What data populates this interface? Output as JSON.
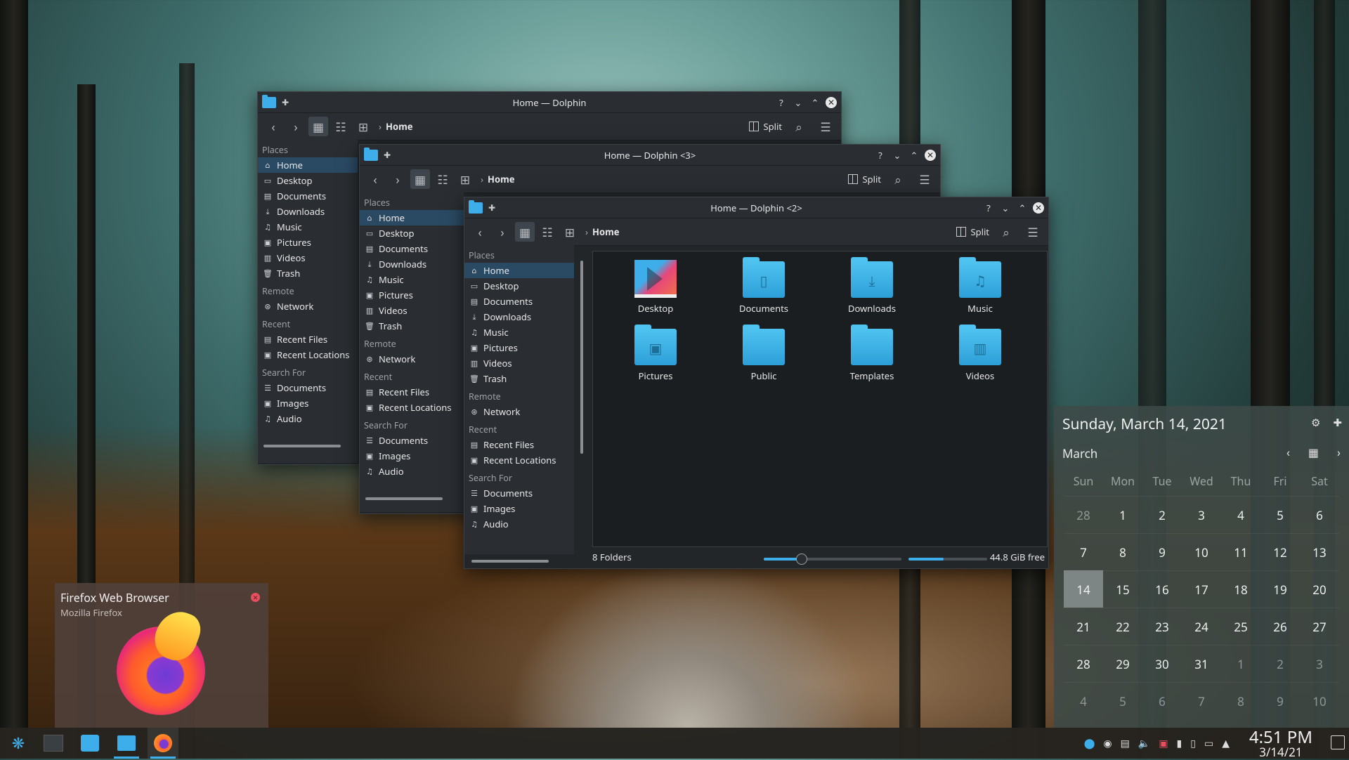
{
  "windows": [
    {
      "title": "Home — Dolphin"
    },
    {
      "title": "Home — Dolphin <3>"
    },
    {
      "title": "Home — Dolphin <2>"
    }
  ],
  "toolbar": {
    "split_label": "Split",
    "breadcrumb": "Home"
  },
  "places": {
    "sections": {
      "places": "Places",
      "remote": "Remote",
      "recent": "Recent",
      "search_for": "Search For"
    },
    "places_items": [
      "Home",
      "Desktop",
      "Documents",
      "Downloads",
      "Music",
      "Pictures",
      "Videos",
      "Trash"
    ],
    "remote_items": [
      "Network"
    ],
    "recent_items": [
      "Recent Files",
      "Recent Locations"
    ],
    "search_items": [
      "Documents",
      "Images",
      "Audio"
    ]
  },
  "files": [
    {
      "name": "Desktop",
      "icon": "desktop-folder-icon"
    },
    {
      "name": "Documents",
      "icon": "documents-folder-icon"
    },
    {
      "name": "Downloads",
      "icon": "downloads-folder-icon"
    },
    {
      "name": "Music",
      "icon": "music-folder-icon"
    },
    {
      "name": "Pictures",
      "icon": "pictures-folder-icon"
    },
    {
      "name": "Public",
      "icon": "folder-icon"
    },
    {
      "name": "Templates",
      "icon": "folder-icon"
    },
    {
      "name": "Videos",
      "icon": "videos-folder-icon"
    }
  ],
  "statusbar": {
    "folders": "8 Folders",
    "free": "44.8 GiB free",
    "zoom_fraction": 0.27,
    "disk_used_fraction": 0.45
  },
  "calendar": {
    "full_date": "Sunday, March 14, 2021",
    "month": "March",
    "weekdays": [
      "Sun",
      "Mon",
      "Tue",
      "Wed",
      "Thu",
      "Fri",
      "Sat"
    ],
    "days": [
      [
        "28",
        "1",
        "2",
        "3",
        "4",
        "5",
        "6"
      ],
      [
        "7",
        "8",
        "9",
        "10",
        "11",
        "12",
        "13"
      ],
      [
        "14",
        "15",
        "16",
        "17",
        "18",
        "19",
        "20"
      ],
      [
        "21",
        "22",
        "23",
        "24",
        "25",
        "26",
        "27"
      ],
      [
        "28",
        "29",
        "30",
        "31",
        "1",
        "2",
        "3"
      ],
      [
        "4",
        "5",
        "6",
        "7",
        "8",
        "9",
        "10"
      ]
    ],
    "today": "14"
  },
  "notification": {
    "title": "Firefox Web Browser",
    "subtitle": "Mozilla Firefox"
  },
  "taskbar": {
    "time": "4:51 PM",
    "date": "3/14/21"
  },
  "colors": {
    "accent": "#3daee9",
    "window_bg": "#232629",
    "panel_bg": "#2a2e32"
  }
}
